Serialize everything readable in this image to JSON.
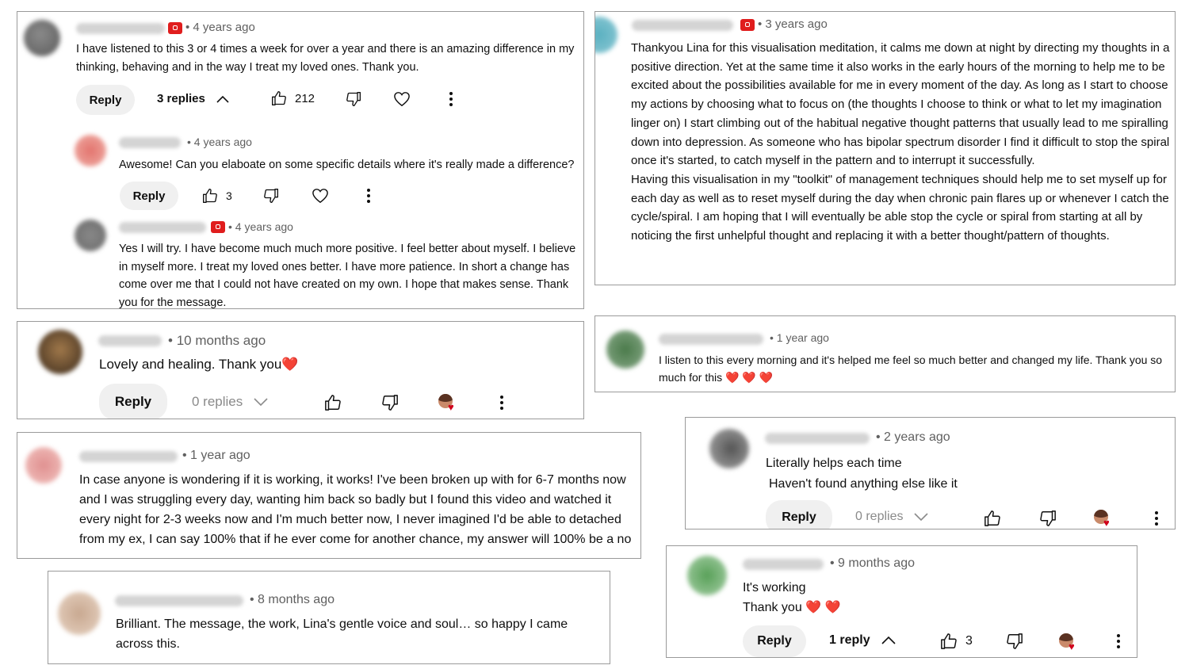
{
  "icons": {
    "like": "thumbs-up-icon",
    "dislike": "thumbs-down-icon",
    "heart": "heart-icon",
    "more": "more-vertical-icon",
    "chevron_up": "chevron-up-icon",
    "chevron_down": "chevron-down-icon",
    "member": "member-badge-icon"
  },
  "colors": {
    "accent_heart": "#e2262b",
    "meta_text": "#606060",
    "button_bg": "#f0f0f0",
    "badge_red": "#e01d1d"
  },
  "c1": {
    "time": "4 years ago",
    "text": "I have listened to this 3 or 4 times a week for over a year and there is an amazing difference in my thinking, behaving and in the way I treat my loved ones. Thank you.",
    "reply_label": "Reply",
    "replies_label": "3 replies",
    "likes": "212",
    "r1": {
      "time": "4 years ago",
      "text": "Awesome! Can you elaboate on some specific details where it's really made a difference?",
      "reply_label": "Reply",
      "likes": "3"
    },
    "r2": {
      "time": "4 years ago",
      "text": "Yes I will try. I have become much much more positive. I feel better about myself. I believe in myself more. I treat  my loved ones better. I have more patience. In short a change has come over me that I could not have created on my own. I hope that makes sense. Thank you for the message."
    }
  },
  "c2": {
    "time": "3 years ago",
    "text1": "Thankyou Lina for this visualisation meditation, it calms me down at night by directing my thoughts in a positive direction. Yet at the same time it also works in the early hours of the morning to help me to be excited about the possibilities available for me in every moment of the day. As long as I start to choose my actions by choosing what to focus on (the thoughts I choose to think or what to let my imagination linger on) I start climbing out of the habitual negative thought patterns that usually lead to me spiralling down into depression. As someone who has bipolar spectrum disorder I find it difficult to stop the spiral once it's started, to catch myself in the pattern and to interrupt it successfully.",
    "text2": "Having this visualisation in my \"toolkit\" of management techniques should help me to set myself up for each day as well as to reset myself during the day when chronic pain flares up or whenever I catch the cycle/spiral. I am hoping that I will eventually be able stop the cycle or spiral from starting at all by noticing the first unhelpful thought and replacing it with a better thought/pattern of thoughts."
  },
  "c3": {
    "time": "10 months ago",
    "text": "Lovely and healing. Thank you",
    "emoji": "❤️",
    "reply_label": "Reply",
    "replies_label": "0 replies"
  },
  "c4": {
    "time": "1 year ago",
    "text": "I listen to this every morning and it's helped me feel so much better and changed my life. Thank you so much for this",
    "emoji": "❤️ ❤️ ❤️"
  },
  "c5": {
    "time": "2 years ago",
    "line1": "Literally helps each time",
    "line2": "Haven't found anything else like it",
    "reply_label": "Reply",
    "replies_label": "0 replies"
  },
  "c6": {
    "time": "1 year ago",
    "text": "In case anyone is wondering if it is working, it works! I've been broken up with for 6-7 months now and I was struggling every day, wanting him back so badly but I found this video and watched it every night for 2-3 weeks now and I'm much better now, I never imagined I'd be able to detached from my ex, I can say 100% that if he ever come for another chance, my answer will 100% be a no"
  },
  "c7": {
    "time": "9 months ago",
    "line1": "It's working",
    "line2": "Thank you",
    "emoji": "❤️ ❤️",
    "reply_label": "Reply",
    "replies_label": "1 reply",
    "likes": "3"
  },
  "c8": {
    "time": "8 months ago",
    "text": "Brilliant.  The message, the work, Lina's gentle voice and soul… so happy I came across this."
  }
}
